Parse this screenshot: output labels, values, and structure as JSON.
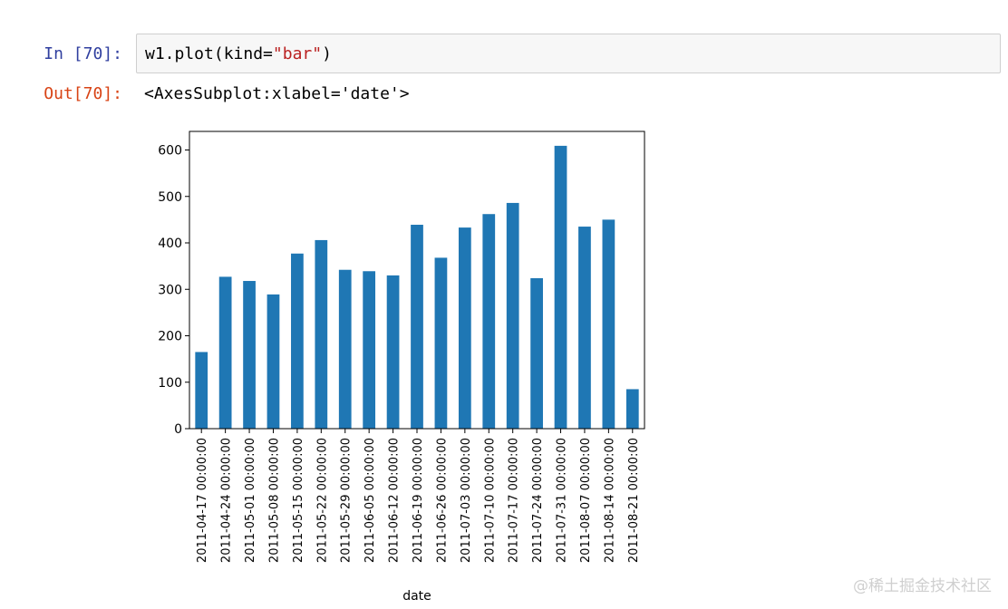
{
  "input": {
    "prompt": "In  [70]:",
    "code_prefix": "w1.plot(kind=",
    "code_string": "\"bar\"",
    "code_suffix": ")"
  },
  "output": {
    "prompt": "Out[70]:",
    "text": "<AxesSubplot:xlabel='date'>"
  },
  "watermark": "@稀土掘金技术社区",
  "chart_data": {
    "type": "bar",
    "title": "",
    "xlabel": "date",
    "ylabel": "",
    "categories": [
      "2011-04-17 00:00:00",
      "2011-04-24 00:00:00",
      "2011-05-01 00:00:00",
      "2011-05-08 00:00:00",
      "2011-05-15 00:00:00",
      "2011-05-22 00:00:00",
      "2011-05-29 00:00:00",
      "2011-06-05 00:00:00",
      "2011-06-12 00:00:00",
      "2011-06-19 00:00:00",
      "2011-06-26 00:00:00",
      "2011-07-03 00:00:00",
      "2011-07-10 00:00:00",
      "2011-07-17 00:00:00",
      "2011-07-24 00:00:00",
      "2011-07-31 00:00:00",
      "2011-08-07 00:00:00",
      "2011-08-14 00:00:00",
      "2011-08-21 00:00:00"
    ],
    "values": [
      165,
      327,
      318,
      289,
      377,
      406,
      342,
      339,
      330,
      439,
      368,
      433,
      462,
      486,
      324,
      609,
      435,
      450,
      85
    ],
    "yticks": [
      "0",
      "100",
      "200",
      "300",
      "400",
      "500",
      "600"
    ],
    "ylim": [
      0,
      640
    ],
    "grid": false,
    "bar_color": "#1f77b4"
  }
}
